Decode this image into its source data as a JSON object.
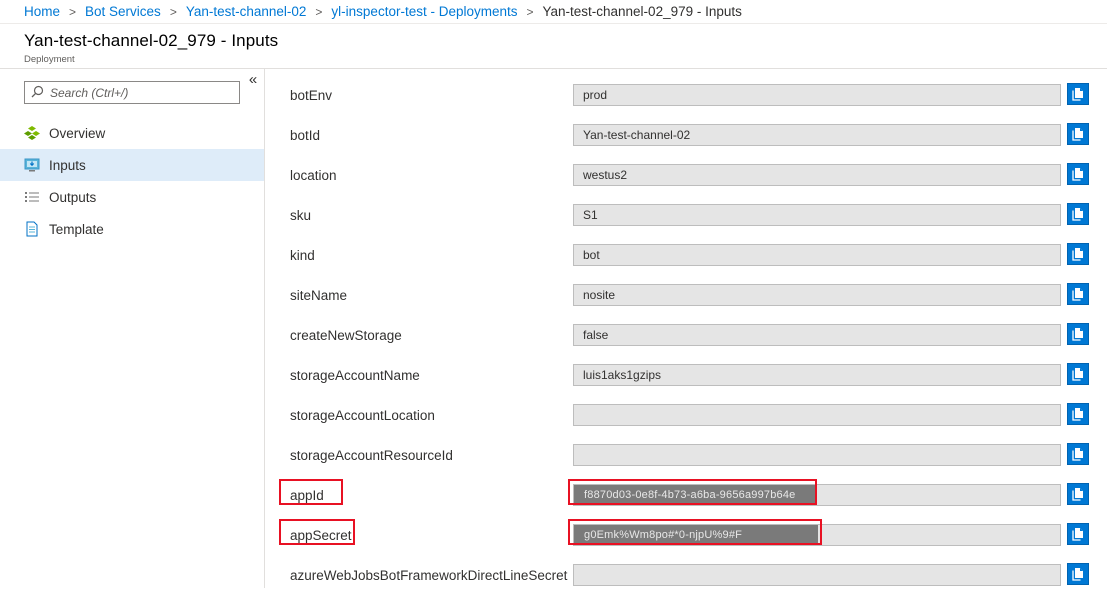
{
  "breadcrumb": {
    "items": [
      "Home",
      "Bot Services",
      "Yan-test-channel-02",
      "yl-inspector-test - Deployments"
    ],
    "current": "Yan-test-channel-02_979 - Inputs"
  },
  "header": {
    "title": "Yan-test-channel-02_979 - Inputs",
    "subtitle": "Deployment"
  },
  "sidebar": {
    "collapse_glyph": "«",
    "search_placeholder": "Search (Ctrl+/)",
    "items": [
      {
        "label": "Overview",
        "icon": "overview-icon",
        "active": false
      },
      {
        "label": "Inputs",
        "icon": "inputs-icon",
        "active": true
      },
      {
        "label": "Outputs",
        "icon": "outputs-icon",
        "active": false
      },
      {
        "label": "Template",
        "icon": "template-icon",
        "active": false
      }
    ]
  },
  "inputs": [
    {
      "name": "botEnv",
      "value": "prod"
    },
    {
      "name": "botId",
      "value": "Yan-test-channel-02"
    },
    {
      "name": "location",
      "value": "westus2"
    },
    {
      "name": "sku",
      "value": "S1"
    },
    {
      "name": "kind",
      "value": "bot"
    },
    {
      "name": "siteName",
      "value": "nosite"
    },
    {
      "name": "createNewStorage",
      "value": "false"
    },
    {
      "name": "storageAccountName",
      "value": "luis1aks1gzips"
    },
    {
      "name": "storageAccountLocation",
      "value": ""
    },
    {
      "name": "storageAccountResourceId",
      "value": ""
    },
    {
      "name": "appId",
      "value": "",
      "redacted": "f8870d03-0e8f-4b73-a6ba-9656a997b64e",
      "highlighted": true
    },
    {
      "name": "appSecret",
      "value": "",
      "redacted": "g0Emk%Wm8po#*0-njpU%9#F",
      "highlighted": true
    },
    {
      "name": "azureWebJobsBotFrameworkDirectLineSecret",
      "value": ""
    }
  ],
  "colors": {
    "accent": "#0078d4",
    "highlight": "#e81123",
    "active_nav": "#deecf9"
  }
}
